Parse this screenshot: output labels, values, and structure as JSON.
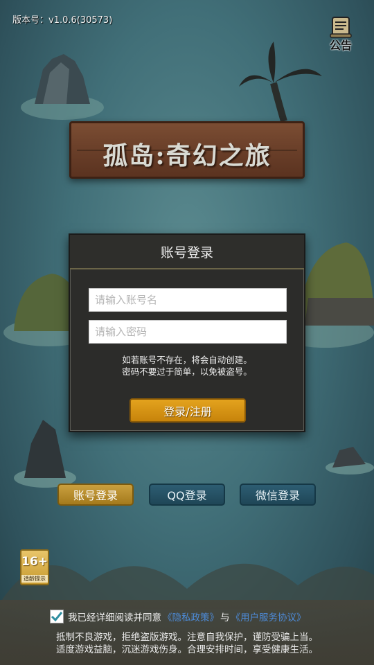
{
  "version_text": "版本号：v1.0.6(30573)",
  "notice_button": {
    "label": "公告",
    "icon": "scroll-icon"
  },
  "game_title": "孤岛:奇幻之旅",
  "login_dialog": {
    "title": "账号登录",
    "account_placeholder": "请输入账号名",
    "account_value": "",
    "password_placeholder": "请输入密码",
    "password_value": "",
    "hint_line1": "如若账号不存在，将会自动创建。",
    "hint_line2": "密码不要过于简单，以免被盗号。",
    "submit_label": "登录/注册"
  },
  "login_methods": {
    "account": "账号登录",
    "qq": "QQ登录",
    "wechat": "微信登录"
  },
  "age_rating": {
    "number": "16+",
    "label": "适龄提示"
  },
  "agreement": {
    "checked": true,
    "text": "我已经详细阅读并同意",
    "privacy_link": "《隐私政策》",
    "connector": "与",
    "terms_link": "《用户服务协议》"
  },
  "health_notice": {
    "line1": "抵制不良游戏，拒绝盗版游戏。注意自我保护，谨防受骗上当。",
    "line2": "适度游戏益脑，沉迷游戏伤身。合理安排时间，享受健康生活。"
  },
  "colors": {
    "accent_gold": "#e3a31e",
    "tab_blue": "#1f4657",
    "link_blue": "#4d8bd8",
    "dialog_bg": "#2c2c2a"
  }
}
